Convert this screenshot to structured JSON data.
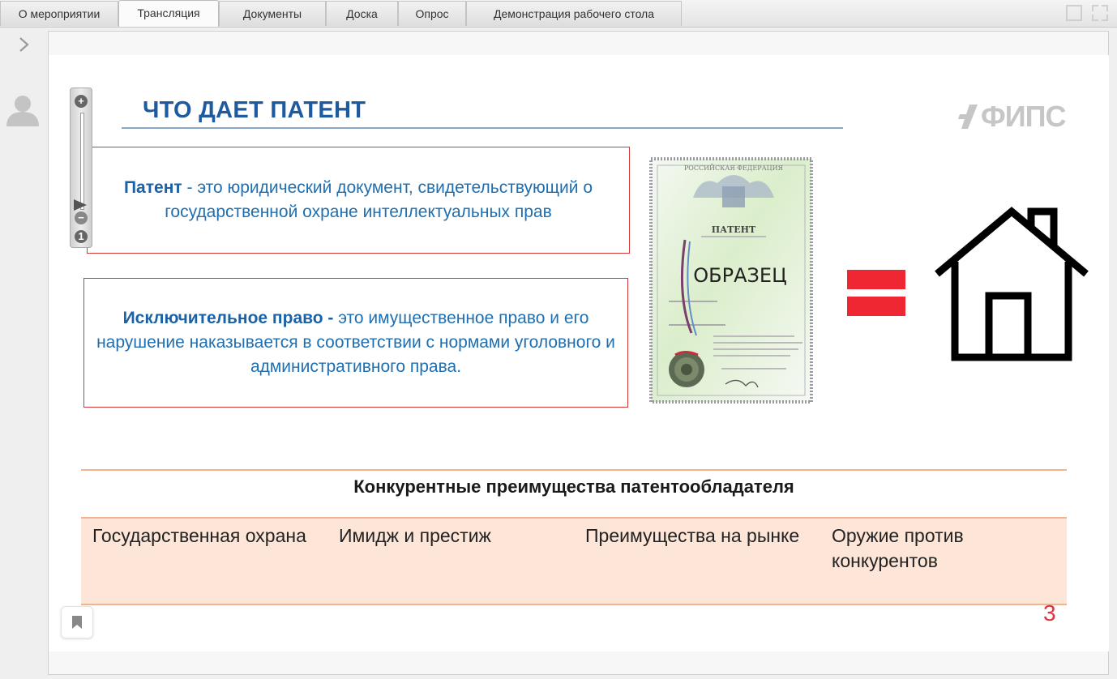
{
  "tabs": [
    {
      "label": "О мероприятии",
      "active": false
    },
    {
      "label": "Трансляция",
      "active": true
    },
    {
      "label": "Документы",
      "active": false
    },
    {
      "label": "Доска",
      "active": false
    },
    {
      "label": "Опрос",
      "active": false
    },
    {
      "label": "Демонстрация рабочего стола",
      "active": false
    }
  ],
  "slide": {
    "title": "ЧТО ДАЕТ ПАТЕНТ",
    "logo_text": "ФИПС",
    "box1": {
      "term": "Патент",
      "text": " - это юридический документ, свидетельствующий о государственной охране интеллектуальных прав"
    },
    "box2": {
      "term": "Исключительное право - ",
      "text": "это имущественное право и его нарушение наказывается в соответствии с нормами уголовного и административного права."
    },
    "certificate": {
      "country": "РОССИЙСКАЯ ФЕДЕРАЦИЯ",
      "heading": "ПАТЕНТ",
      "stamp": "ОБРАЗЕЦ"
    },
    "section_title": "Конкурентные преимущества патентообладателя",
    "benefits": [
      "Государственная охрана",
      "Имидж и престиж",
      "Преимущества на рынке",
      "Оружие против конкурентов"
    ],
    "page_number": "3"
  },
  "zoom": {
    "plus": "+",
    "minus": "−",
    "reset": "1"
  },
  "colors": {
    "title_blue": "#1d5aa0",
    "box_border": "#d23838",
    "equals_red": "#ee2733",
    "benefit_bg": "#fde5d7",
    "accent_orange": "#f1b48e"
  }
}
